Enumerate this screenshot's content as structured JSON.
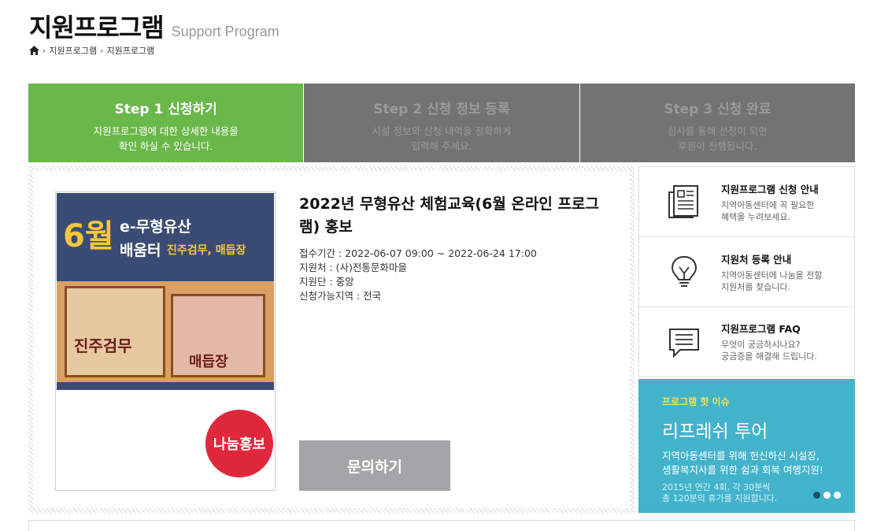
{
  "header": {
    "title": "지원프로그램",
    "subtitle": "Support Program"
  },
  "breadcrumb": {
    "items": [
      "지원프로그램",
      "지원프로그램"
    ]
  },
  "steps": [
    {
      "title": "Step 1 신청하기",
      "desc": "지원프로그램에 대한 상세한 내용을\n확인 하실 수 있습니다."
    },
    {
      "title": "Step 2 신청 정보 등록",
      "desc": "시설 정보와 신청 내역을 정확하게\n입력해 주세요."
    },
    {
      "title": "Step 3 신청 완료",
      "desc": "심사를 통해 선정이 되면\n후원이 진행됩니다."
    }
  ],
  "poster": {
    "month": "6월",
    "line1": "e-무형유산",
    "line2": "배움터",
    "line3": "진주검무, 매듭장",
    "caption1": "진주검무",
    "caption2": "매듭장"
  },
  "badge": "나눔홍보",
  "post": {
    "title": "2022년 무형유산 체험교육(6월 온라인 프로그램) 홍보",
    "period": "접수기간 : 2022-06-07 09:00 ~ 2022-06-24 17:00",
    "supporter": "지원처 : (사)전통문화마을",
    "group": "지원단 : 중앙",
    "region": "신청가능지역 : 전국",
    "button": "문의하기"
  },
  "side": [
    {
      "title": "지원프로그램 신청 안내",
      "desc": "지역아동센터에 꼭 필요한\n혜택을 누려보세요.",
      "icon": "document-icon"
    },
    {
      "title": "지원처 등록 안내",
      "desc": "지역아동센터에 나눔을 전할\n지원처를 찾습니다.",
      "icon": "lightbulb-icon"
    },
    {
      "title": "지원프로그램 FAQ",
      "desc": "무엇이 궁금하시나요?\n궁금증을 해결해 드립니다.",
      "icon": "chat-icon"
    }
  ],
  "hot": {
    "label": "프로그램 핫 이슈",
    "title": "리프레쉬 투어",
    "desc": "지역아동센터를 위해 헌신하신 시설장,\n생활복지사를 위한 쉼과 회복 여행지원!",
    "sub": "2015년 연간 4회, 각 30분씩\n총 120분의 휴가를 지원합니다."
  },
  "colors": {
    "active_step": "#6ab74a",
    "inactive_step": "#737373",
    "hot_bg": "#43b3cc",
    "badge": "#e0283d"
  }
}
